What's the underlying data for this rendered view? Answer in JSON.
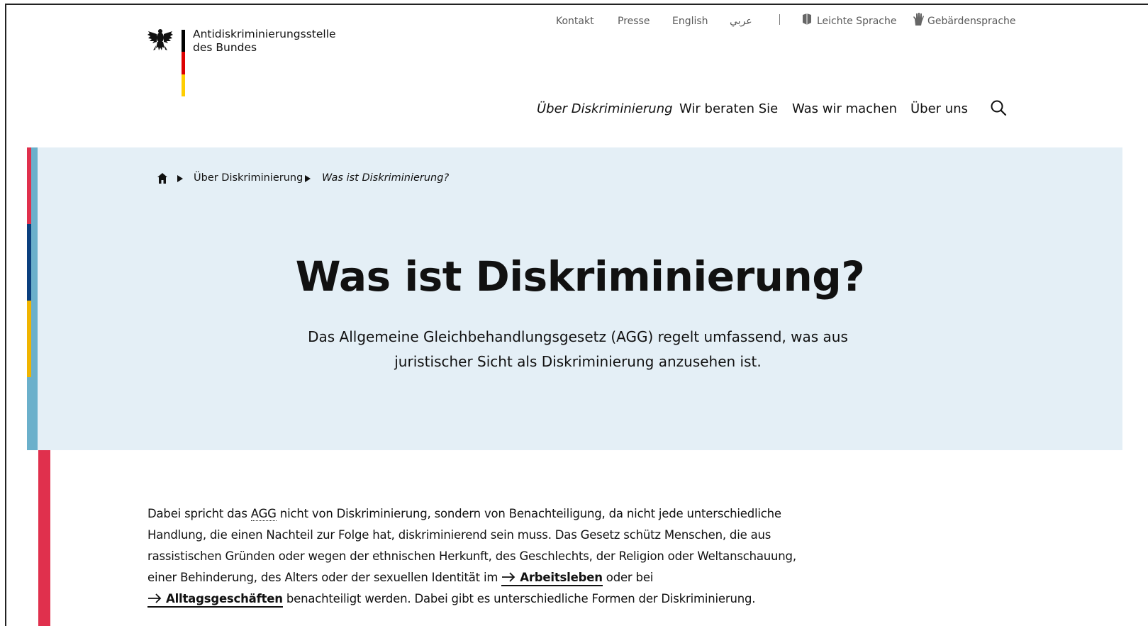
{
  "logo": {
    "line1": "Antidiskriminierungsstelle",
    "line2": "des Bundes",
    "icon": "federal-eagle-icon",
    "flag_colors": [
      "#000000",
      "#dd0000",
      "#ffce00"
    ]
  },
  "meta_nav": {
    "contact": "Kontakt",
    "press": "Presse",
    "english": "English",
    "arabic": "عربي",
    "easy_language": "Leichte Sprache",
    "easy_language_icon": "easy-language-icon",
    "sign_language": "Gebärdensprache",
    "sign_language_icon": "sign-language-icon"
  },
  "main_nav": {
    "item1": "Über Diskriminierung",
    "item2": "Wir beraten Sie",
    "item3": "Was wir machen",
    "item4": "Über uns",
    "search_icon": "search-icon"
  },
  "breadcrumb": {
    "home_icon": "home-icon",
    "level1": "Über Diskriminierung",
    "current": "Was ist Diskriminierung?"
  },
  "hero": {
    "title": "Was ist Diskriminierung?",
    "subtitle_line1": "Das Allgemeine Gleichbehandlungsgesetz (AGG) regelt umfassend, was aus",
    "subtitle_line2": "juristischer Sicht als Diskriminierung anzusehen ist."
  },
  "content": {
    "l1_a": "Dabei spricht das ",
    "abbr": "AGG",
    "l1_b": " nicht von Diskriminierung, sondern von Benachteiligung, da nicht jede unterschiedliche",
    "l2": "Handlung, die einen Nachteil zur Folge hat, diskriminierend sein muss. Das Gesetz schütz Menschen, die aus",
    "l3": "rassistischen Gründen oder wegen der ethnischen Herkunft, des Geschlechts, der Religion oder Weltanschauung,",
    "l4_a": "einer Behinderung, des Alters oder der sexuellen Identität im ",
    "link1": "Arbeitsleben",
    "l4_b": " oder bei",
    "link2": "Alltagsgeschäften",
    "l5_b": " benachteiligt werden. Dabei gibt es unterschiedliche Formen der Diskriminierung."
  },
  "colors": {
    "hero_bg": "#e4eff6",
    "stripe_blue": "#6bb0cb",
    "accent_red": "#e0304d",
    "accent_navy": "#0b3f7e",
    "accent_yellow": "#f0b400"
  }
}
